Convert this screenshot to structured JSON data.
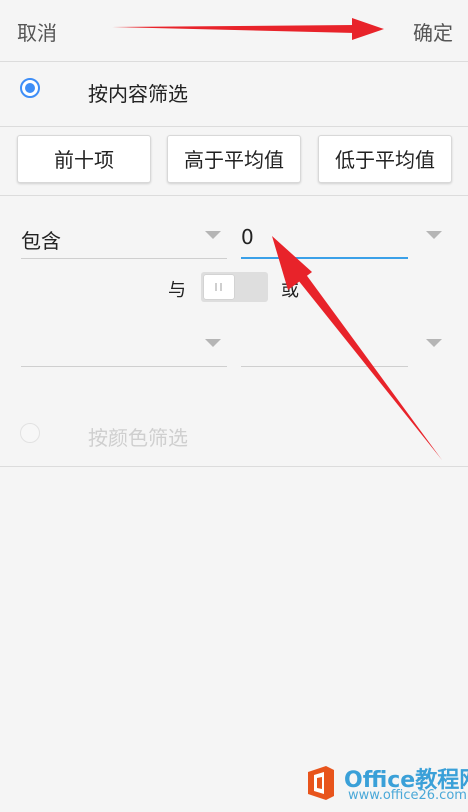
{
  "topbar": {
    "cancel_label": "取消",
    "confirm_label": "确定"
  },
  "filter_by_content": {
    "label": "按内容筛选",
    "selected": true
  },
  "quick_buttons": [
    {
      "label": "前十项"
    },
    {
      "label": "高于平均值"
    },
    {
      "label": "低于平均值"
    }
  ],
  "condition1": {
    "operator": "包含",
    "value": "0"
  },
  "logic": {
    "and_label": "与",
    "or_label": "或"
  },
  "condition2": {
    "operator": "",
    "value": ""
  },
  "filter_by_color": {
    "label": "按颜色筛选",
    "selected": false
  },
  "watermark": {
    "title": "Office教程网",
    "url": "www.office26.com"
  },
  "colors": {
    "accent": "#3e8ef7",
    "underline_active": "#3aa0e8",
    "annotation_arrow": "#e8232a"
  }
}
